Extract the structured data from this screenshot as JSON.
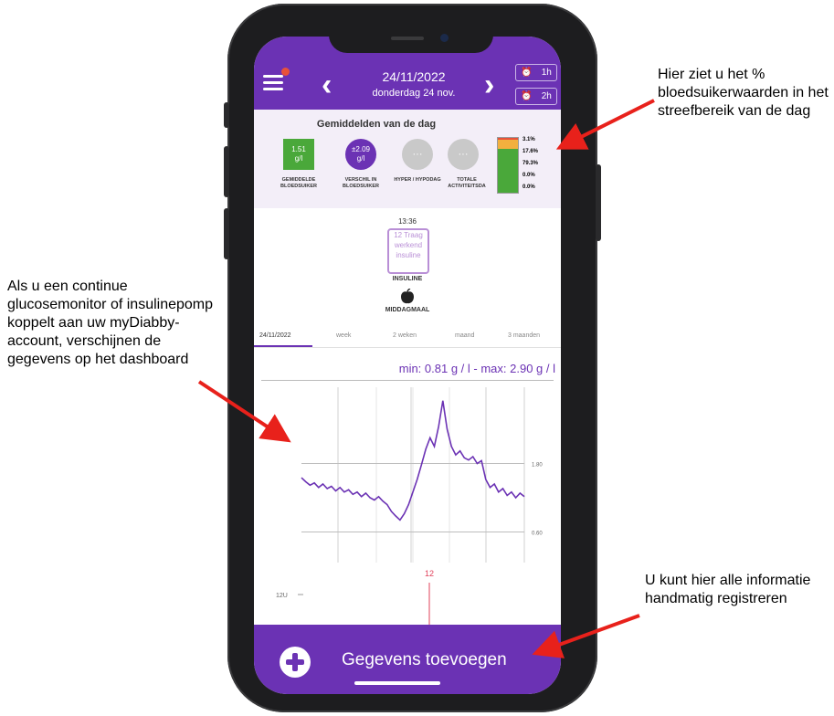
{
  "annotations": {
    "left": "Als u een continue glucosemonitor of insulinepomp koppelt aan uw myDiabby-account, verschijnen de gegevens op het dashboard",
    "top_right": "Hier ziet u het % bloedsuikerwaarden in het streefbereik van de dag",
    "bottom_right": "U kunt hier alle informatie handmatig registreren"
  },
  "header": {
    "date": "24/11/2022",
    "day": "donderdag 24 nov.",
    "prev_icon": "‹",
    "next_icon": "›",
    "timer_1": "1h",
    "timer_2": "2h",
    "accent_color": "#6b32b4"
  },
  "summary": {
    "title": "Gemiddelden van de dag",
    "stats": [
      {
        "value": "1.51",
        "unit": "g/l",
        "label": "GEMIDDELDE BLOEDSUIKER",
        "color": "#4aa83a"
      },
      {
        "value": "±2.09",
        "unit": "g/l",
        "label": "VERSCHIL IN BLOEDSUIKER",
        "color": "#6b32b4"
      },
      {
        "value": "···",
        "unit": "",
        "label": "HYPER / HYPODAG",
        "color": "#c9c9c9"
      },
      {
        "value": "···",
        "unit": "",
        "label": "TOTALE ACTIVITEITSDA",
        "color": "#c9c9c9"
      }
    ],
    "time_in_range": [
      {
        "pct": "3.1%",
        "color": "#e8513a",
        "fraction": 0.031
      },
      {
        "pct": "17.6%",
        "color": "#f2b03e",
        "fraction": 0.176
      },
      {
        "pct": "79.3%",
        "color": "#4aa83a",
        "fraction": 0.793
      },
      {
        "pct": "0.0%",
        "color": "#3aa6e0",
        "fraction": 0
      },
      {
        "pct": "0.0%",
        "color": "#1b3a8a",
        "fraction": 0
      }
    ]
  },
  "events": {
    "time": "13:36",
    "insulin_text": "12 Traag werkend insuline",
    "insulin_label": "INSULINE",
    "meal_icon": "apple-icon",
    "meal_label": "MIDDAGMAAL"
  },
  "tabs": [
    "24/11/2022",
    "week",
    "2 weken",
    "maand",
    "3 maanden"
  ],
  "chart": {
    "min_label": "min: 0.81 g / l",
    "separator": " - ",
    "max_label": "max: 2.90 g / l",
    "insulin_bar_label": "12",
    "insulin_axis_label": "12U"
  },
  "chart_data": {
    "type": "line",
    "title": "",
    "xlabel": "",
    "ylabel": "",
    "reference_lines": [
      "1.80",
      "0.60"
    ],
    "series": [
      {
        "values": [
          1.55,
          1.48,
          1.42,
          1.46,
          1.38,
          1.44,
          1.36,
          1.4,
          1.32,
          1.38,
          1.3,
          1.34,
          1.26,
          1.3,
          1.22,
          1.28,
          1.2,
          1.16,
          1.22,
          1.14,
          1.08,
          0.96,
          0.88,
          0.81,
          0.92,
          1.08,
          1.3,
          1.52,
          1.78,
          2.05,
          2.25,
          2.1,
          2.45,
          2.9,
          2.4,
          2.1,
          1.95,
          2.02,
          1.9,
          1.86,
          1.92,
          1.8,
          1.85,
          1.52,
          1.38,
          1.44,
          1.3,
          1.36,
          1.24,
          1.3,
          1.2,
          1.28,
          1.22
        ]
      }
    ]
  }
}
